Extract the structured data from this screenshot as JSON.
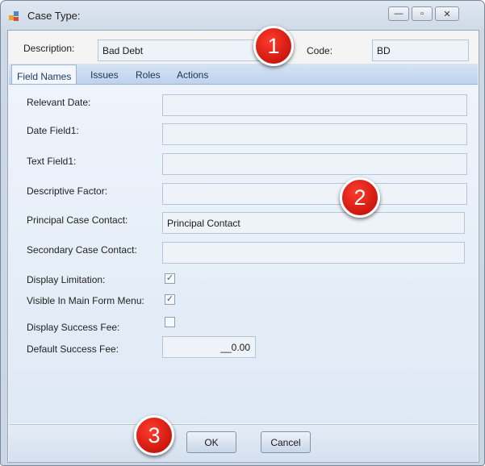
{
  "window": {
    "title": "Case Type:",
    "controls": {
      "minimize": "—",
      "maximize": "▫",
      "close": "✕"
    }
  },
  "header": {
    "description_label": "Description:",
    "description_value": "Bad Debt",
    "code_label": "Code:",
    "code_value": "BD"
  },
  "tabs": [
    {
      "label": "Field Names",
      "active": true
    },
    {
      "label": "Issues"
    },
    {
      "label": "Roles"
    },
    {
      "label": "Actions"
    }
  ],
  "fields": {
    "relevant_date_label": "Relevant  Date:",
    "date_field1_label": "Date Field1:",
    "text_field1_label": "Text Field1:",
    "descriptive_factor_label": "Descriptive Factor:",
    "principal_contact_label": "Principal Case Contact:",
    "principal_contact_value": "Principal Contact",
    "secondary_contact_label": "Secondary Case Contact:",
    "display_limitation_label": "Display Limitation:",
    "display_limitation_checked": true,
    "visible_main_menu_label": "Visible In Main Form Menu:",
    "visible_main_menu_checked": true,
    "display_success_fee_label": "Display Success Fee:",
    "display_success_fee_checked": false,
    "default_success_fee_label": "Default Success Fee:",
    "default_success_fee_value": "__0.00"
  },
  "buttons": {
    "ok": "OK",
    "cancel": "Cancel"
  },
  "callouts": [
    "1",
    "2",
    "3"
  ],
  "colors": {
    "callout_red": "#d11a10",
    "tab_strip": "#bed2ec"
  }
}
